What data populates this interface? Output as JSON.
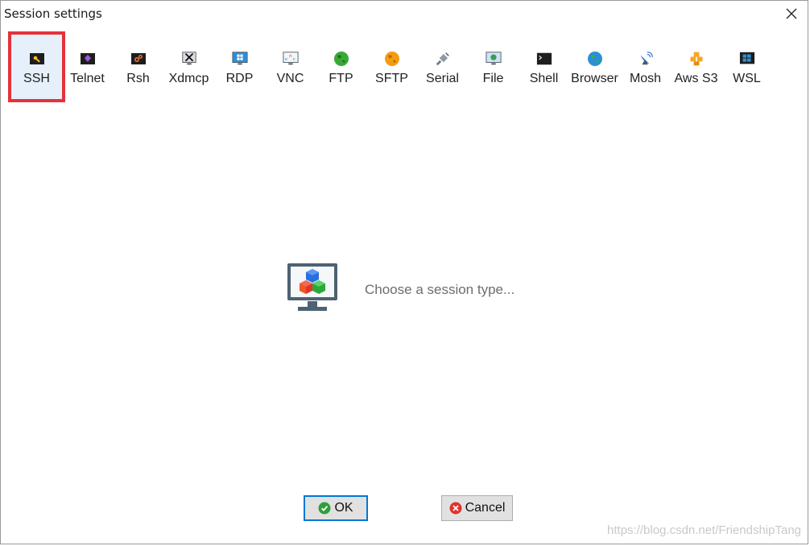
{
  "window": {
    "title": "Session settings"
  },
  "session_types": [
    {
      "label": "SSH",
      "icon": "key-icon",
      "selected": true
    },
    {
      "label": "Telnet",
      "icon": "telnet-icon"
    },
    {
      "label": "Rsh",
      "icon": "rsh-icon"
    },
    {
      "label": "Xdmcp",
      "icon": "x-icon"
    },
    {
      "label": "RDP",
      "icon": "windows-monitor-icon"
    },
    {
      "label": "VNC",
      "icon": "vnc-icon"
    },
    {
      "label": "FTP",
      "icon": "globe-green-icon"
    },
    {
      "label": "SFTP",
      "icon": "globe-orange-icon"
    },
    {
      "label": "Serial",
      "icon": "serial-plug-icon"
    },
    {
      "label": "File",
      "icon": "file-monitor-icon"
    },
    {
      "label": "Shell",
      "icon": "terminal-icon"
    },
    {
      "label": "Browser",
      "icon": "globe-blue-icon"
    },
    {
      "label": "Mosh",
      "icon": "satellite-icon"
    },
    {
      "label": "Aws S3",
      "icon": "aws-cubes-icon"
    },
    {
      "label": "WSL",
      "icon": "windows-logo-icon"
    }
  ],
  "main": {
    "hint": "Choose a session type..."
  },
  "buttons": {
    "ok_label": "OK",
    "cancel_label": "Cancel"
  },
  "watermark": "https://blog.csdn.net/FriendshipTang",
  "colors": {
    "selection_outline": "#e5323a",
    "selection_bg": "#e6f0fa",
    "ok_focus": "#0078d7"
  }
}
